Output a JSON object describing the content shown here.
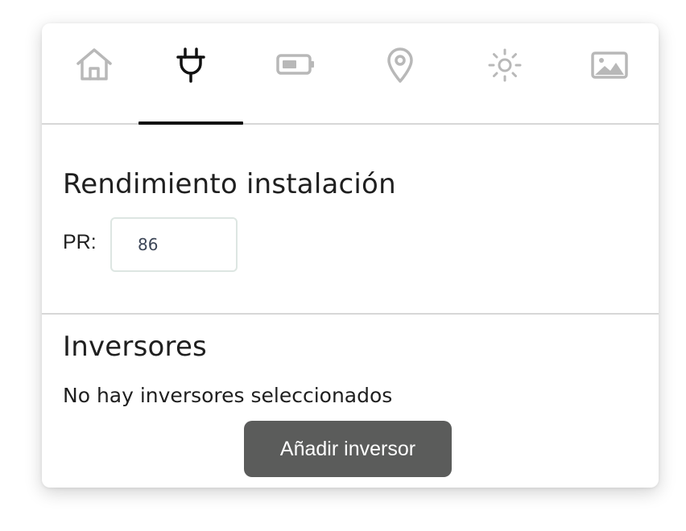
{
  "tabs": [
    {
      "icon": "home-icon",
      "active": false
    },
    {
      "icon": "plug-icon",
      "active": true
    },
    {
      "icon": "battery-icon",
      "active": false
    },
    {
      "icon": "location-pin-icon",
      "active": false
    },
    {
      "icon": "sun-icon",
      "active": false
    },
    {
      "icon": "image-icon",
      "active": false
    }
  ],
  "colors": {
    "active_icon": "#111111",
    "inactive_icon": "#b8b8b8",
    "button_bg": "#5b5c5b"
  },
  "performance": {
    "title": "Rendimiento instalación",
    "pr_label": "PR:",
    "pr_value": "86"
  },
  "inverters": {
    "title": "Inversores",
    "empty_message": "No hay inversores seleccionados",
    "add_button_label": "Añadir inversor"
  }
}
